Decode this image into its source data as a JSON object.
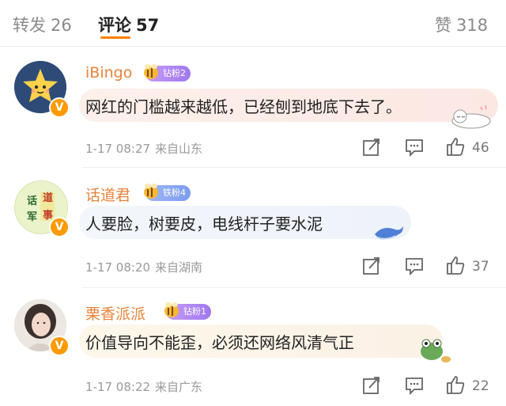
{
  "tabs": {
    "repost_label": "转发",
    "repost_count": "26",
    "comment_label": "评论",
    "comment_count": "57",
    "like_label": "赞",
    "like_count": "318"
  },
  "colors": {
    "accent": "#ff8200",
    "username": "#e8843c",
    "verified": "#ff9a00"
  },
  "comments": [
    {
      "username": "iBingo",
      "fan_badge": "钻粉2",
      "text": "网红的门槛越来越低，已经刨到地底下去了。",
      "time": "1-17 08:27",
      "location": "来自山东",
      "likes": "46",
      "avatar_icon": "star-face-icon",
      "sticker_icon": "sleeping-cat-sticker"
    },
    {
      "username": "话道君",
      "fan_badge": "铁粉4",
      "text": "人要脸，树要皮，电线杆子要水泥",
      "time": "1-17 08:20",
      "location": "来自湖南",
      "likes": "37",
      "avatar_text": [
        "话",
        "道",
        "军",
        "事"
      ],
      "sticker_icon": "whale-sticker"
    },
    {
      "username": "栗香派派",
      "fan_badge": "钻粉1",
      "text": "价值导向不能歪，必须还网络风清气正",
      "time": "1-17 08:22",
      "location": "来自广东",
      "likes": "22",
      "avatar_icon": "woman-portrait-icon",
      "sticker_icon": "frog-sticker"
    }
  ]
}
